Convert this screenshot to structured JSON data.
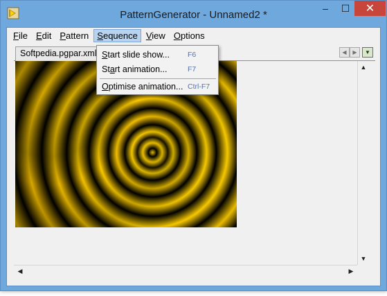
{
  "window": {
    "title": "PatternGenerator - Unnamed2 *",
    "controls": {
      "minimize": "–",
      "maximize": "☐",
      "close": "✕"
    }
  },
  "menubar": {
    "items": [
      {
        "first": "F",
        "rest": "ile"
      },
      {
        "first": "E",
        "rest": "dit"
      },
      {
        "first": "P",
        "rest": "attern"
      },
      {
        "first": "S",
        "rest": "equence"
      },
      {
        "first": "V",
        "rest": "iew"
      },
      {
        "first": "O",
        "rest": "ptions"
      }
    ]
  },
  "tabs": {
    "active_label": "Softpedia.pgpar.xml",
    "nav_left": "◀",
    "nav_right": "▶",
    "nav_menu": "▼"
  },
  "sequence_menu": {
    "items": [
      {
        "first": "S",
        "rest": "tart slide show...",
        "shortcut": "F6"
      },
      {
        "pre": "St",
        "mn": "a",
        "post": "rt animation...",
        "shortcut": "F7"
      },
      {
        "first": "O",
        "rest": "ptimise animation...",
        "shortcut": "Ctrl-F7"
      }
    ]
  },
  "scrollbars": {
    "up": "▲",
    "down": "▼",
    "left": "◀",
    "right": "▶"
  },
  "colors": {
    "pattern_gold": "#ffd400",
    "pattern_dark": "#000000",
    "close_button": "#c7453b",
    "active_menu": "#b9d3ee"
  }
}
